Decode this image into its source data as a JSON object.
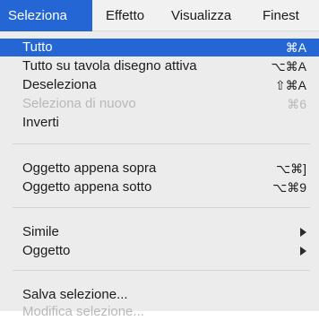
{
  "menubar": {
    "items": [
      "Seleziona",
      "Effetto",
      "Visualizza",
      "Finest"
    ]
  },
  "menu": {
    "items": [
      {
        "label": "Tutto",
        "shortcut": "⌘A",
        "state": "highlighted"
      },
      {
        "label": "Tutto su tavola disegno attiva",
        "shortcut": "⌥⌘A",
        "state": "enabled"
      },
      {
        "label": "Deseleziona",
        "shortcut": "⇧⌘A",
        "state": "enabled"
      },
      {
        "label": "Seleziona di nuovo",
        "shortcut": "⌘6",
        "state": "disabled"
      },
      {
        "label": "Inverti",
        "shortcut": "",
        "state": "enabled"
      },
      {
        "label": "Oggetto appena sopra",
        "shortcut": "⌥⌘]",
        "state": "enabled"
      },
      {
        "label": "Oggetto appena sotto",
        "shortcut": "⌥⌘9",
        "state": "enabled"
      },
      {
        "label": "Simile",
        "shortcut": "",
        "state": "enabled",
        "submenu": true
      },
      {
        "label": "Oggetto",
        "shortcut": "",
        "state": "enabled",
        "submenu": true
      },
      {
        "label": "Salva selezione...",
        "shortcut": "",
        "state": "enabled"
      },
      {
        "label": "Modifica selezione...",
        "shortcut": "",
        "state": "disabled"
      }
    ]
  },
  "colors": {
    "highlight": "#2466d3",
    "menu_background": "#ececec",
    "disabled_text": "#b8b8b8"
  }
}
